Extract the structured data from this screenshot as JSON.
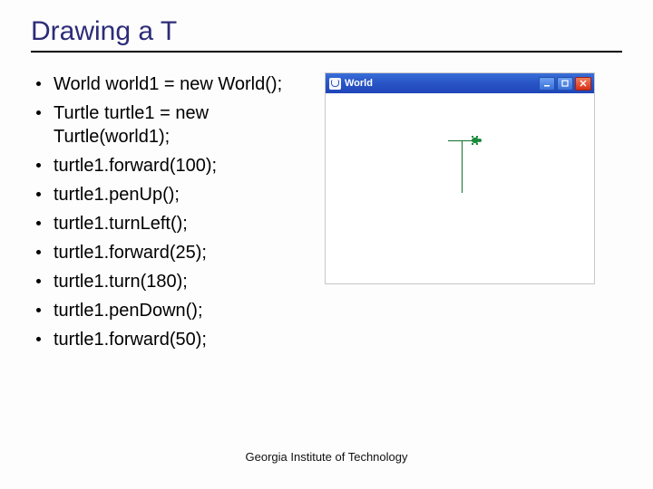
{
  "title": "Drawing a T",
  "bullets": [
    "World world1 = new World();",
    "Turtle turtle1 = new Turtle(world1);",
    "turtle1.forward(100);",
    "turtle1.penUp();",
    "turtle1.turnLeft();",
    "turtle1.forward(25);",
    "turtle1.turn(180);",
    "turtle1.penDown();",
    "turtle1.forward(50);"
  ],
  "window": {
    "title": "World"
  },
  "footer": "Georgia Institute of Technology"
}
